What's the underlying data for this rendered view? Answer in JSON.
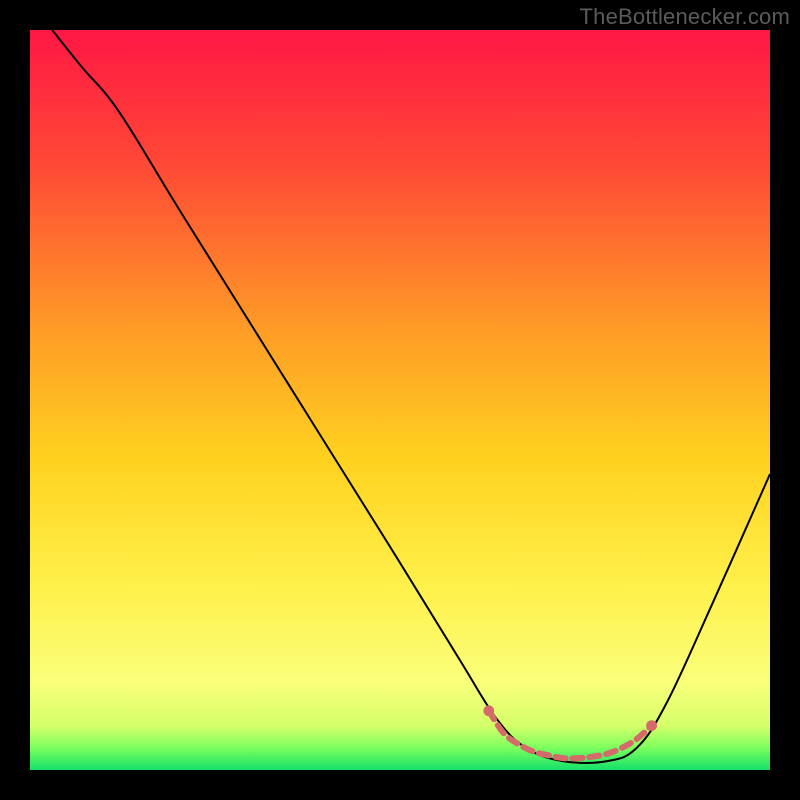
{
  "watermark": "TheBottlenecker.com",
  "chart_data": {
    "type": "line",
    "title": "",
    "xlabel": "",
    "ylabel": "",
    "xlim": [
      0,
      100
    ],
    "ylim": [
      0,
      100
    ],
    "gradient_stops": [
      {
        "offset": 0,
        "color": "#ff1744"
      },
      {
        "offset": 18,
        "color": "#ff4836"
      },
      {
        "offset": 40,
        "color": "#ff9a27"
      },
      {
        "offset": 58,
        "color": "#ffd21f"
      },
      {
        "offset": 75,
        "color": "#fff04a"
      },
      {
        "offset": 88,
        "color": "#faff7a"
      },
      {
        "offset": 94,
        "color": "#d6ff6a"
      },
      {
        "offset": 97,
        "color": "#7cff5e"
      },
      {
        "offset": 100,
        "color": "#15e06a"
      }
    ],
    "series": [
      {
        "name": "bottleneck-curve",
        "color": "#000000",
        "width": 2,
        "points": [
          {
            "x": 3,
            "y": 100
          },
          {
            "x": 7,
            "y": 95
          },
          {
            "x": 12,
            "y": 89
          },
          {
            "x": 20,
            "y": 76
          },
          {
            "x": 30,
            "y": 60
          },
          {
            "x": 40,
            "y": 44
          },
          {
            "x": 50,
            "y": 28
          },
          {
            "x": 58,
            "y": 15
          },
          {
            "x": 63,
            "y": 7
          },
          {
            "x": 67,
            "y": 3
          },
          {
            "x": 72,
            "y": 1.2
          },
          {
            "x": 78,
            "y": 1.2
          },
          {
            "x": 82,
            "y": 3
          },
          {
            "x": 86,
            "y": 9
          },
          {
            "x": 92,
            "y": 22
          },
          {
            "x": 100,
            "y": 40
          }
        ]
      },
      {
        "name": "optimal-band-marker",
        "color": "#d46a6a",
        "width": 6,
        "points": [
          {
            "x": 62,
            "y": 8
          },
          {
            "x": 64,
            "y": 5
          },
          {
            "x": 66,
            "y": 3.5
          },
          {
            "x": 68,
            "y": 2.5
          },
          {
            "x": 70,
            "y": 2
          },
          {
            "x": 72,
            "y": 1.6
          },
          {
            "x": 74,
            "y": 1.6
          },
          {
            "x": 76,
            "y": 1.8
          },
          {
            "x": 78,
            "y": 2.2
          },
          {
            "x": 80,
            "y": 3
          },
          {
            "x": 82,
            "y": 4.2
          },
          {
            "x": 84,
            "y": 6
          }
        ]
      }
    ]
  }
}
